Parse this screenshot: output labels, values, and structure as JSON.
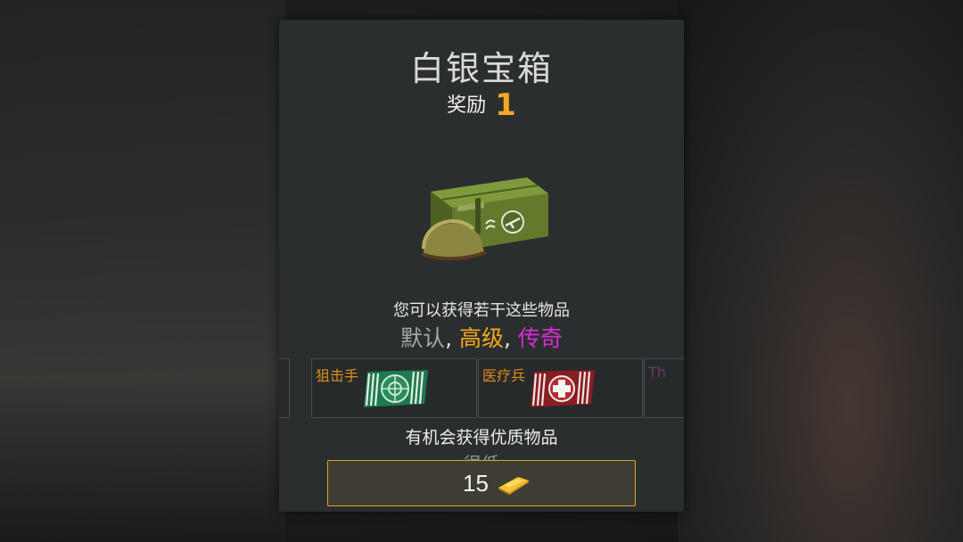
{
  "chest": {
    "title": "白银宝箱",
    "reward_label": "奖励",
    "reward_count": "1",
    "description": "您可以获得若干这些物品"
  },
  "rarities": {
    "default": "默认",
    "advanced": "高级",
    "legendary": "传奇",
    "separator": ","
  },
  "items": [
    {
      "label": "狙击手",
      "icon": "sniper-badge-icon"
    },
    {
      "label": "医疗兵",
      "icon": "medic-badge-icon"
    },
    {
      "label": "Th",
      "icon": "partial-item-icon"
    }
  ],
  "quality_odds": {
    "label": "有机会获得优质物品",
    "value": "很低"
  },
  "purchase": {
    "price": "15",
    "currency_icon": "gold-bar-icon"
  },
  "colors": {
    "advanced": "#f3a81d",
    "legendary": "#d92cd5",
    "default": "#a6a8a9",
    "button_border": "#d9a52a"
  }
}
